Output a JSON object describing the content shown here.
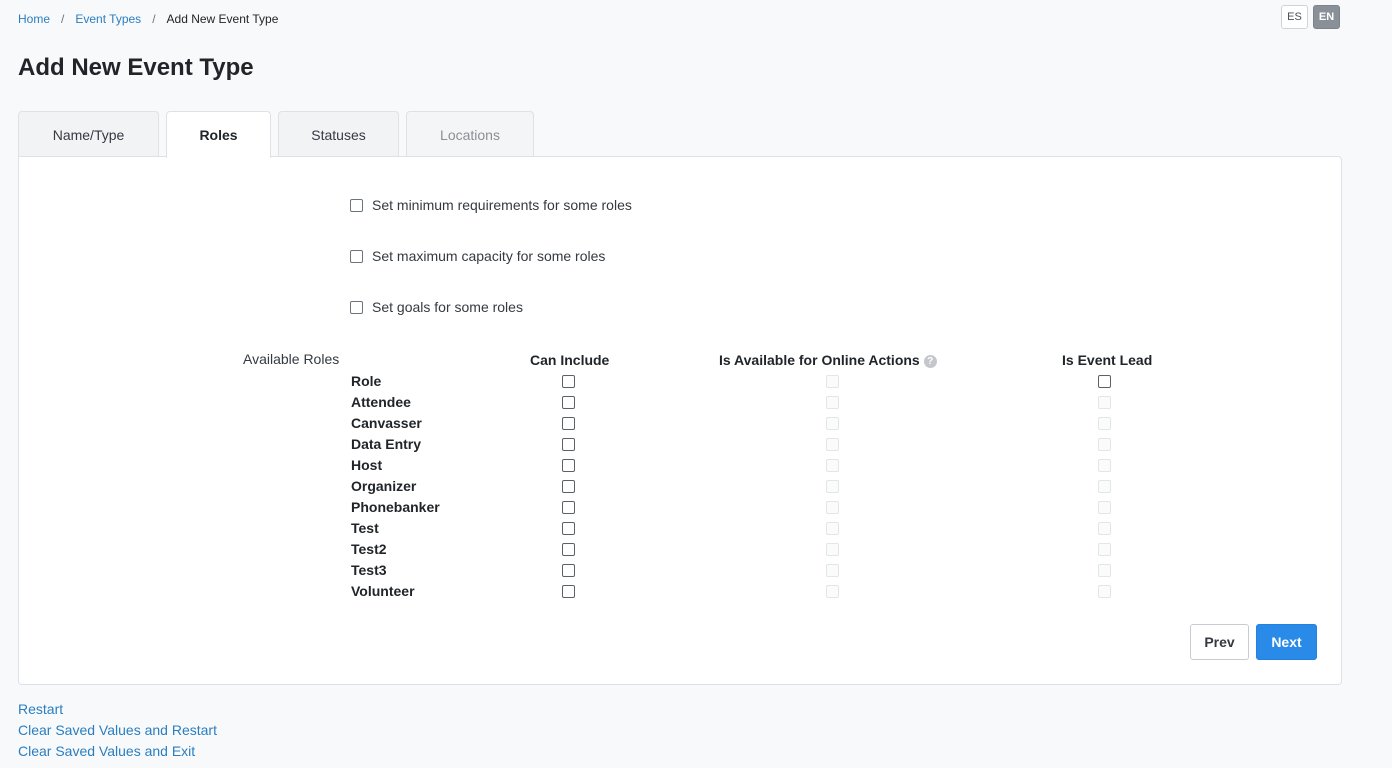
{
  "breadcrumb": {
    "items": [
      "Home",
      "Event Types"
    ],
    "current": "Add New Event Type",
    "separator": "/"
  },
  "lang": {
    "es": "ES",
    "en": "EN",
    "active": "EN"
  },
  "page_title": "Add New Event Type",
  "tabs": [
    {
      "label": "Name/Type",
      "state": "normal"
    },
    {
      "label": "Roles",
      "state": "active"
    },
    {
      "label": "Statuses",
      "state": "normal"
    },
    {
      "label": "Locations",
      "state": "disabled"
    }
  ],
  "options": [
    {
      "label": "Set minimum requirements for some roles",
      "checked": false
    },
    {
      "label": "Set maximum capacity for some roles",
      "checked": false
    },
    {
      "label": "Set goals for some roles",
      "checked": false
    }
  ],
  "roles_table": {
    "available_label": "Available Roles",
    "headers": {
      "can_include": "Can Include",
      "online": "Is Available for Online Actions",
      "event_lead": "Is Event Lead"
    },
    "help_icon": "question-circle-icon",
    "rows": [
      {
        "name": "Role",
        "can_include": false,
        "online_enabled": false,
        "lead_enabled": true
      },
      {
        "name": "Attendee",
        "can_include": false,
        "online_enabled": false,
        "lead_enabled": false
      },
      {
        "name": "Canvasser",
        "can_include": false,
        "online_enabled": false,
        "lead_enabled": false
      },
      {
        "name": "Data Entry",
        "can_include": false,
        "online_enabled": false,
        "lead_enabled": false
      },
      {
        "name": "Host",
        "can_include": false,
        "online_enabled": false,
        "lead_enabled": false
      },
      {
        "name": "Organizer",
        "can_include": false,
        "online_enabled": false,
        "lead_enabled": false
      },
      {
        "name": "Phonebanker",
        "can_include": false,
        "online_enabled": false,
        "lead_enabled": false
      },
      {
        "name": "Test",
        "can_include": false,
        "online_enabled": false,
        "lead_enabled": false
      },
      {
        "name": "Test2",
        "can_include": false,
        "online_enabled": false,
        "lead_enabled": false
      },
      {
        "name": "Test3",
        "can_include": false,
        "online_enabled": false,
        "lead_enabled": false
      },
      {
        "name": "Volunteer",
        "can_include": false,
        "online_enabled": false,
        "lead_enabled": false
      }
    ]
  },
  "buttons": {
    "prev": "Prev",
    "next": "Next"
  },
  "footer_links": [
    "Restart",
    "Clear Saved Values and Restart",
    "Clear Saved Values and Exit"
  ],
  "colors": {
    "link": "#2a7ec0",
    "primary_button": "#2a8ae8",
    "background": "#f8f9fa"
  }
}
